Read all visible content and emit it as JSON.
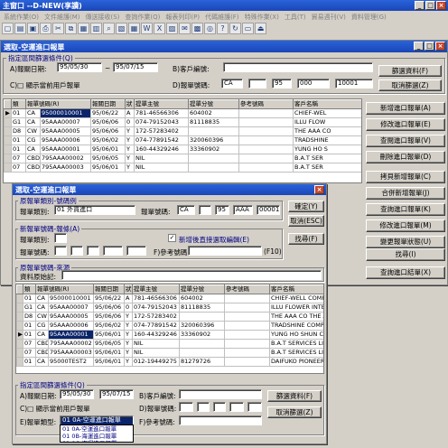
{
  "main_window": {
    "title": "主窗口 --D-NEW(享讀)"
  },
  "menu": [
    "系統作業(O)",
    "文件維護(M)",
    "傳送接收(S)",
    "查詢作業(Q)",
    "報表列印(P)",
    "代碼維護(F)",
    "特殊作業(X)",
    "工具(T)",
    "貿易週刊(V)",
    "資料管理(G)"
  ],
  "toolbar_icons": [
    "new-icon",
    "open-icon",
    "save-icon",
    "print-icon",
    "cut-icon",
    "copy-icon",
    "paste-icon",
    "doc-icon",
    "find-icon",
    "stats-icon",
    "calc-icon",
    "word-icon",
    "excel-icon",
    "pdf-icon",
    "mail-icon",
    "book-icon",
    "globe-icon",
    "help-icon",
    "refresh-icon",
    "lock-icon",
    "exit-icon"
  ],
  "bg_window": {
    "title": "選取-空運進口報單",
    "filter_group": "指定區間篩選條件(Q)",
    "date_label": "A)報關日期:",
    "date_from": "95/05/30",
    "date_to": "95/07/15",
    "tilde": "~",
    "importer_label": "B)客戶編號:",
    "show_all_label": "C)□ 顯示當前用戶報單",
    "decl_no_label": "D)報單號碼:",
    "decl_no": [
      "CA",
      "",
      "95",
      "000",
      "10001"
    ],
    "filter_button": "篩選資料(F)",
    "cancel_filter_button": "取消篩選(Z)",
    "columns": [
      "類",
      "報單號碼(R)",
      "報關日期",
      "狀",
      "提單主號",
      "提單分號",
      "參考號碼",
      "客戶名稱"
    ],
    "rows": [
      [
        "01",
        "CA",
        "95000010001",
        "95/06/22",
        "A",
        "781-46566306",
        "604002",
        "",
        "CHIEF-WEL"
      ],
      [
        "G1",
        "CA",
        "95AAA00007",
        "95/06/06",
        "0",
        "074-79152043",
        "81118835",
        "",
        "ILLU FLOW"
      ],
      [
        "D8",
        "CW",
        "95AAA00005",
        "95/06/06",
        "Y",
        "172-57283402",
        "",
        "",
        "THE AAA CO"
      ],
      [
        "01",
        "CG",
        "95AAA00006",
        "95/06/02",
        "Y",
        "074-77891542",
        "320060396",
        "",
        "TRADSHINE"
      ],
      [
        "01",
        "CA",
        "95AAA00001",
        "95/06/01",
        "Y",
        "160-44329246",
        "33360902",
        "",
        "YUNG HO S"
      ],
      [
        "07",
        "CBD",
        "795AAA00002",
        "95/06/05",
        "Y",
        "NIL",
        "",
        "",
        "B.A.T SER"
      ],
      [
        "07",
        "CBD",
        "795AAA00003",
        "95/06/01",
        "Y",
        "NIL",
        "",
        "",
        "B.A.T SER"
      ]
    ],
    "side_buttons": [
      "新增進口報單(A)",
      "修改進口報單(E)",
      "查閱進口報單(V)",
      "刪除進口報單(D)",
      "拷貝新增報單(C)",
      "合併新增報單(J)",
      "查詢進口報單(K)",
      "修改進口報單(M)",
      "變更報單狀態(U)",
      "最後開啟號碼(L)"
    ],
    "find_button": "找尋(I)",
    "query_button": "查詢進口結單(X)"
  },
  "fg_window": {
    "title": "選取-空運進口報單",
    "group1": "原報單類別-號碼例",
    "type_label": "報單類別:",
    "type_value": "01  外貨進口",
    "no_label": "報單號碼:",
    "no_value": [
      "CA",
      "",
      "95",
      "AAA",
      "00001"
    ],
    "ok_button": "確定(Y)",
    "cancel_button": "取消(ESC)",
    "find_button": "找尋(F)",
    "group2": "新報單號碼-報條(A)",
    "new_type_label": "報單類別:",
    "new_no_label": "報單號碼:",
    "auto_check_label": "新增後直接選取編輯(E)",
    "ref_label": "F)參考號碼:",
    "f10": "(F10)",
    "group3": "原報單號碼-來源",
    "lookup_label": "資料原始記:",
    "columns": [
      "類",
      "報單號碼(R)",
      "報關日期",
      "狀",
      "提單主號",
      "提單分號",
      "參考號碼",
      "客戶名稱"
    ],
    "rows": [
      [
        "01",
        "CA",
        "95000010001",
        "95/06/22",
        "A",
        "781-46566306",
        "604002",
        "",
        "CHIEF-WELL COMPUTER  ABC  A BRE"
      ],
      [
        "G1",
        "CA",
        "95AAA00007",
        "95/06/06",
        "0",
        "074-79152043",
        "81118835",
        "",
        "ILLU FLOWER INTERNAT MANCAY Y SE"
      ],
      [
        "D8",
        "CW",
        "95AAA00005",
        "95/06/06",
        "Y",
        "172-57283402",
        "",
        "",
        "THE AAA CO  THE AAA CO."
      ],
      [
        "01",
        "CG",
        "95AAA00006",
        "95/06/02",
        "Y",
        "074-77891542",
        "320060396",
        "",
        "TRADSHINE COMPUTER CO LT ZANGOO GROU"
      ],
      [
        "01",
        "CA",
        "95AAA00001",
        "95/06/01",
        "Y",
        "160-44329246",
        "33360902",
        "",
        "YUNG HO SHUN CO., LT NSK LTD."
      ],
      [
        "07",
        "CBD",
        "795AAA00002",
        "95/06/05",
        "Y",
        "NIL",
        "",
        "",
        "B.A.T SERVICES LIMIT JAVA AN INT"
      ],
      [
        "07",
        "CBD",
        "795AAA00003",
        "95/06/01",
        "Y",
        "NIL",
        "",
        "",
        "B.A.T SERVICES LIMIT JVAN AN INT"
      ],
      [
        "01",
        "CA",
        "95000TEST2",
        "95/06/01",
        "Y",
        "012-19449275",
        "81279726",
        "",
        "DAIFUKO PIONEER CO., DAIFUKO CO."
      ]
    ],
    "filter_group": "指定區間篩選條件(Q)",
    "date_label": "A)報關日期:",
    "date_from": "95/05/30",
    "date_to": "95/07/15",
    "importer_label": "B)客戶編號:",
    "show_all_label": "C)□ 顯示當前用戶報單",
    "decl_no_label": "D)報單號碼:",
    "decl_type_label": "E)報單類型:",
    "decl_type_value": "01 0A-空運進口報單",
    "filter_button": "篩選資料(F)",
    "cancel_filter_button": "取消篩選(Z)",
    "dropdown_options": [
      "01 0A-空運進口報單",
      "01 0A-空運進口報單",
      "01 0B-海運進口報單",
      "01 0C-海運進口報單",
      "01 0D-海運進口報單"
    ]
  }
}
